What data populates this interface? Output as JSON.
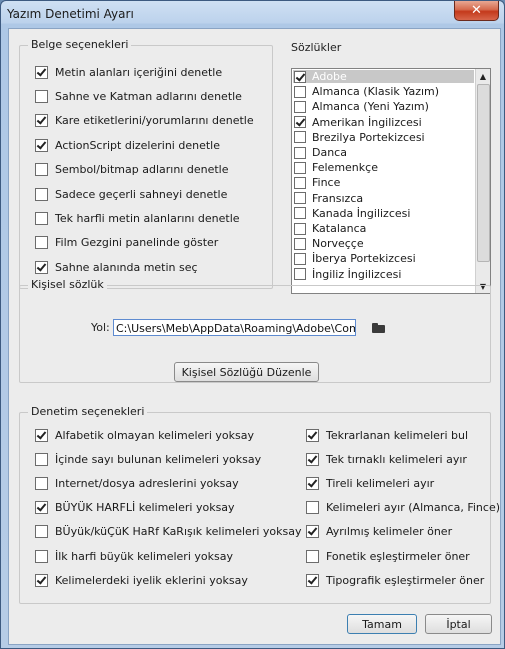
{
  "window": {
    "title": "Yazım Denetimi Ayarı",
    "close_symbol": "✕"
  },
  "belge": {
    "legend": "Belge seçenekleri",
    "options": [
      {
        "label": "Metin alanları içeriğini denetle",
        "checked": true
      },
      {
        "label": "Sahne ve Katman adlarını denetle",
        "checked": false
      },
      {
        "label": "Kare etiketlerini/yorumlarını denetle",
        "checked": true
      },
      {
        "label": "ActionScript dizelerini denetle",
        "checked": true
      },
      {
        "label": "Sembol/bitmap adlarını denetle",
        "checked": false
      },
      {
        "label": "Sadece geçerli sahneyi denetle",
        "checked": false
      },
      {
        "label": "Tek harfli metin alanlarını denetle",
        "checked": false
      },
      {
        "label": "Film Gezgini panelinde göster",
        "checked": false
      },
      {
        "label": "Sahne alanında metin seç",
        "checked": true
      }
    ]
  },
  "sozlukler": {
    "label": "Sözlükler",
    "items": [
      {
        "label": "Adobe",
        "checked": true,
        "selected": true
      },
      {
        "label": "Almanca (Klasik Yazım)",
        "checked": false
      },
      {
        "label": "Almanca (Yeni Yazım)",
        "checked": false
      },
      {
        "label": "Amerikan İngilizcesi",
        "checked": true
      },
      {
        "label": "Brezilya Portekizcesi",
        "checked": false
      },
      {
        "label": "Danca",
        "checked": false
      },
      {
        "label": "Felemenkçe",
        "checked": false
      },
      {
        "label": "Fince",
        "checked": false
      },
      {
        "label": "Fransızca",
        "checked": false
      },
      {
        "label": "Kanada İngilizcesi",
        "checked": false
      },
      {
        "label": "Katalanca",
        "checked": false
      },
      {
        "label": "Norveççe",
        "checked": false
      },
      {
        "label": "İberya Portekizcesi",
        "checked": false
      },
      {
        "label": "İngiliz İngilizcesi",
        "checked": false
      }
    ],
    "scroll_up": "▲",
    "scroll_down": "▼"
  },
  "kisisel": {
    "legend": "Kişisel sözlük",
    "path_label": "Yol:",
    "path_value": "C:\\Users\\Meb\\AppData\\Roaming\\Adobe\\Common\\Persona",
    "edit_button": "Kişisel Sözlüğü Düzenle"
  },
  "denetim": {
    "legend": "Denetim seçenekleri",
    "left": [
      {
        "label": "Alfabetik olmayan kelimeleri yoksay",
        "checked": true
      },
      {
        "label": "İçinde sayı bulunan kelimeleri yoksay",
        "checked": false
      },
      {
        "label": "Internet/dosya adreslerini yoksay",
        "checked": false
      },
      {
        "label": "BÜYÜK HARFLİ kelimeleri yoksay",
        "checked": true
      },
      {
        "label": "BÜyük/küÇüK HaRf KaRışık kelimeleri yoksay",
        "checked": false
      },
      {
        "label": "İlk harfi büyük kelimeleri yoksay",
        "checked": false
      },
      {
        "label": "Kelimelerdeki iyelik eklerini yoksay",
        "checked": true
      }
    ],
    "right": [
      {
        "label": "Tekrarlanan kelimeleri bul",
        "checked": true
      },
      {
        "label": "Tek tırnaklı kelimeleri ayır",
        "checked": true
      },
      {
        "label": "Tireli kelimeleri ayır",
        "checked": true
      },
      {
        "label": "Kelimeleri ayır (Almanca, Fince)",
        "checked": false
      },
      {
        "label": "Ayrılmış kelimeler öner",
        "checked": true
      },
      {
        "label": "Fonetik eşleştirmeler öner",
        "checked": false
      },
      {
        "label": "Tipografik eşleştirmeler öner",
        "checked": true
      }
    ]
  },
  "footer": {
    "ok": "Tamam",
    "cancel": "İptal"
  }
}
